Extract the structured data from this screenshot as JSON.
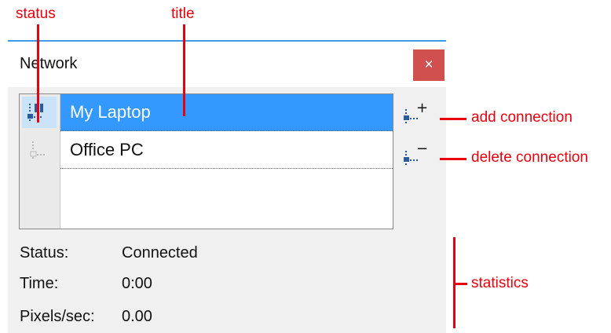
{
  "window": {
    "title": "Network",
    "close_label": "×"
  },
  "connections": [
    {
      "title": "My Laptop",
      "status": "connected",
      "selected": true
    },
    {
      "title": "Office PC",
      "status": "disconnected",
      "selected": false
    }
  ],
  "buttons": {
    "add": {
      "icon": "add-connection-icon",
      "symbol": "+"
    },
    "delete": {
      "icon": "delete-connection-icon",
      "symbol": "−"
    }
  },
  "stats": [
    {
      "label": "Status:",
      "value": "Connected"
    },
    {
      "label": "Time:",
      "value": "0:00"
    },
    {
      "label": "Pixels/sec:",
      "value": "0.00"
    }
  ],
  "annotations": {
    "status": "status",
    "title": "title",
    "add_connection": "add connection",
    "delete_connection": "delete connection",
    "statistics": "statistics"
  },
  "colors": {
    "annotation": "#e8000d",
    "selection": "#3399ff",
    "close_button": "#d05050",
    "window_accent": "#3c9ae6"
  }
}
